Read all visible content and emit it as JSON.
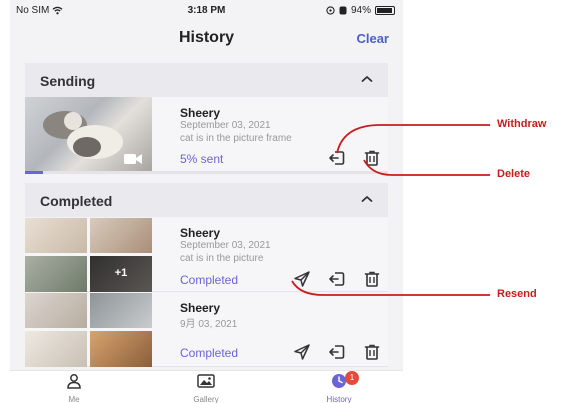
{
  "status_bar": {
    "carrier": "No SIM",
    "time": "3:18 PM",
    "battery": "94%"
  },
  "header": {
    "title": "History",
    "clear_label": "Clear"
  },
  "sections": {
    "sending": {
      "title": "Sending",
      "item": {
        "name": "Sheery",
        "date": "September 03, 2021",
        "caption": "cat is in the picture frame",
        "status": "5% sent",
        "progress": 0.05
      }
    },
    "completed": {
      "title": "Completed",
      "items": [
        {
          "name": "Sheery",
          "date": "September 03, 2021",
          "caption": "cat is in the picture",
          "status": "Completed",
          "more_count": "+1"
        },
        {
          "name": "Sheery",
          "date": "9月 03, 2021",
          "status": "Completed"
        }
      ]
    }
  },
  "tabbar": {
    "tabs": [
      {
        "label": "Me",
        "icon": "person-icon"
      },
      {
        "label": "Gallery",
        "icon": "gallery-icon"
      },
      {
        "label": "History",
        "icon": "clock-icon",
        "badge": "1"
      }
    ],
    "active": "History"
  },
  "annotations": {
    "withdraw": "Withdraw",
    "delete": "Delete",
    "resend": "Resend"
  },
  "colors": {
    "accent": "#6b63d8",
    "clear": "#4a5fc9",
    "annotation": "#cc1b1b",
    "badge": "#e24a3b"
  }
}
